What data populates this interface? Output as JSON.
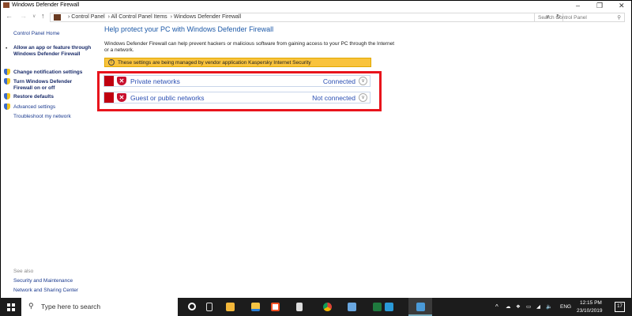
{
  "window": {
    "title": "Windows Defender Firewall"
  },
  "address": {
    "breadcrumb": [
      "Control Panel",
      "All Control Panel Items",
      "Windows Defender Firewall"
    ],
    "search_placeholder": "Search Control Panel"
  },
  "sidebar": {
    "home": "Control Panel Home",
    "items": [
      {
        "label": "Allow an app or feature through Windows Defender Firewall",
        "bold": true
      },
      {
        "label": "Change notification settings",
        "bold": true
      },
      {
        "label": "Turn Windows Defender Firewall on or off",
        "bold": true
      },
      {
        "label": "Restore defaults",
        "bold": true
      },
      {
        "label": "Advanced settings",
        "bold": false
      },
      {
        "label": "Troubleshoot my network",
        "bold": false
      }
    ],
    "see_also": "See also",
    "see_also_links": [
      "Security and Maintenance",
      "Network and Sharing Center"
    ]
  },
  "main": {
    "title": "Help protect your PC with Windows Defender Firewall",
    "description": "Windows Defender Firewall can help prevent hackers or malicious software from gaining access to your PC through the Internet or a network.",
    "warning": "These settings are being managed by vendor application Kaspersky Internet Security",
    "networks": [
      {
        "label": "Private networks",
        "status": "Connected"
      },
      {
        "label": "Guest or public networks",
        "status": "Not connected"
      }
    ]
  },
  "taskbar": {
    "search_placeholder": "Type here to search",
    "time": "12:15 PM",
    "date": "23/10/2019",
    "lang": "ENG",
    "notifications": "17"
  },
  "colors": {
    "highlight": "#e8141c",
    "warning": "#f9c33c",
    "link": "#2b4fb3",
    "shield_red": "#c8102e"
  }
}
